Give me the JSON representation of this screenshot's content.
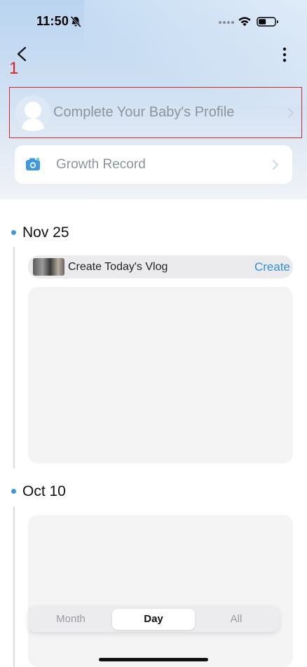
{
  "status_bar": {
    "time": "11:50",
    "icons": [
      "bell-slash-icon",
      "cellular-signal-icon",
      "wifi-icon",
      "battery-icon"
    ]
  },
  "nav": {
    "back_icon": "chevron-left-icon",
    "more_icon": "vertical-ellipsis-icon"
  },
  "annotation": {
    "marker": "1",
    "color": "#e0201c"
  },
  "profile_banner": {
    "label": "Complete Your Baby's Profile",
    "avatar_icon": "baby-avatar-icon",
    "chevron_icon": "chevron-right-icon"
  },
  "growth_record": {
    "label": "Growth Record",
    "icon": "camera-icon",
    "chevron_icon": "chevron-right-icon"
  },
  "timeline": [
    {
      "date": "Nov 25",
      "vlog": {
        "label": "Create Today's Vlog",
        "action": "Create"
      }
    },
    {
      "date": "Oct 10"
    }
  ],
  "view_switch": {
    "options": [
      "Month",
      "Day",
      "All"
    ],
    "selected": "Day"
  },
  "colors": {
    "accent": "#2f8fd6",
    "timeline_dot": "#3d98e0",
    "highlight_border": "#d8262b"
  }
}
